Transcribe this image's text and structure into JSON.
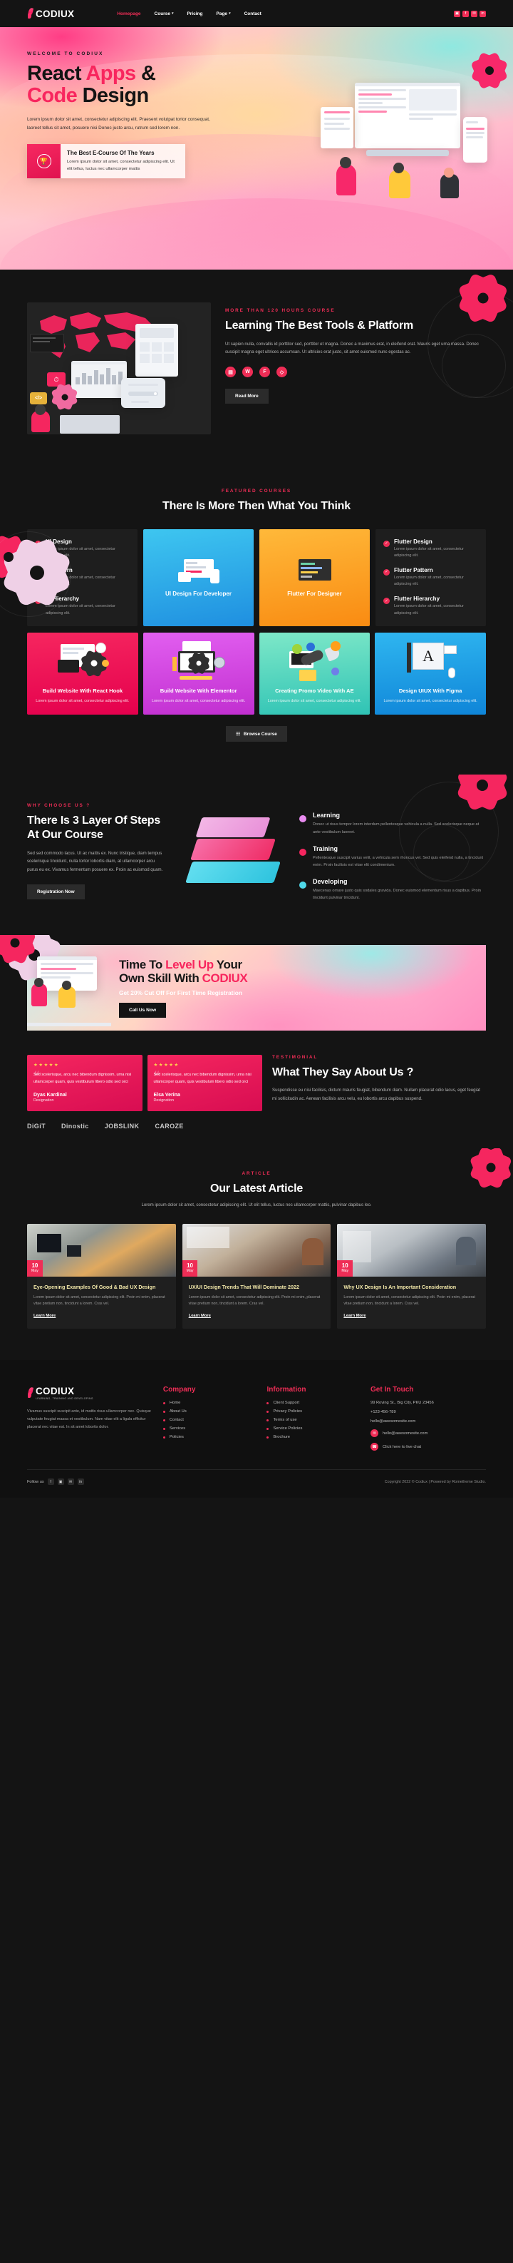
{
  "brand": {
    "name": "CODIUX",
    "tagline": "LEARNING, TRAINING AND DEVELOPING",
    "accent": "#ef2d56",
    "dark": "#141414"
  },
  "nav": {
    "items": [
      {
        "label": "Homepage",
        "active": true,
        "caret": ""
      },
      {
        "label": "Course",
        "active": false,
        "caret": "⌄"
      },
      {
        "label": "Pricing",
        "active": false,
        "caret": ""
      },
      {
        "label": "Page",
        "active": false,
        "caret": "⌄"
      },
      {
        "label": "Contact",
        "active": false,
        "caret": ""
      }
    ],
    "social": [
      {
        "name": "instagram-icon",
        "glyph": "▣"
      },
      {
        "name": "facebook-icon",
        "glyph": "f"
      },
      {
        "name": "twitter-icon",
        "glyph": "✉"
      },
      {
        "name": "linkedin-icon",
        "glyph": "in"
      }
    ]
  },
  "hero": {
    "eyebrow": "WELCOME TO CODIUX",
    "title_1a": "React ",
    "title_1b": "Apps",
    "title_1c": " &",
    "title_2a": "Code ",
    "title_2b": "Design",
    "paragraph": "Lorem ipsum dolor sit amet, consectetur adipiscing elit. Praesent volutpat tortor consequat, laoreet tellus sit amet, posuere nisi Donec justo arcu, rutrum sed lorem non.",
    "card": {
      "icon": "trophy-icon",
      "title": "The Best E-Course Of The Years",
      "text": "Lorem ipsum dolor sit amet, consectetur adipiscing elit. Ut elit tellus, luctus nec ullamcorper mattis"
    }
  },
  "learning": {
    "eyebrow": "MORE THAN 120 HOURS COURSE",
    "title": "Learning The Best Tools & Platform",
    "paragraph": "Ut sapien nulla, convallis id porttitor sed, porttitor et magna. Donec a maximus erat, in eleifend erat. Mauris eget urna massa. Donec suscipit magna eget ultrices accumsan. Ut ultricies erat justo, sit amet euismod nunc egestas ac.",
    "tools": [
      {
        "name": "elementor-icon",
        "glyph": "▤"
      },
      {
        "name": "wordpress-icon",
        "glyph": "W"
      },
      {
        "name": "figma-icon",
        "glyph": "F"
      },
      {
        "name": "sketch-icon",
        "glyph": "◇"
      }
    ],
    "button": "Read More"
  },
  "featured": {
    "eyebrow": "FEATURED COURSES",
    "title": "There Is More Then What You Think",
    "col1": [
      {
        "title": "UI Design",
        "text": "Lorem ipsum dolor sit amet, consectetur adipiscing elit."
      },
      {
        "title": "UI Pattern",
        "text": "Lorem ipsum dolor sit amet, consectetur adipiscing elit."
      },
      {
        "title": "UI Hierarchy",
        "text": "Lorem ipsum dolor sit amet, consectetur adipiscing elit."
      }
    ],
    "promo1": {
      "title": "UI Design For Developer"
    },
    "promo2": {
      "title": "Flutter For Designer"
    },
    "col4": [
      {
        "title": "Flutter Design",
        "text": "Lorem ipsum dolor sit amet, consectetur adipiscing elit."
      },
      {
        "title": "Flutter Pattern",
        "text": "Lorem ipsum dolor sit amet, consectetur adipiscing elit."
      },
      {
        "title": "Flutter Hierarchy",
        "text": "Lorem ipsum dolor sit amet, consectetur adipiscing elit."
      }
    ],
    "cards": [
      {
        "title": "Build Website With React Hook",
        "text": "Lorem ipsum dolor sit amet, consectetur adipiscing elit."
      },
      {
        "title": "Build Website With Elementor",
        "text": "Lorem ipsum dolor sit amet, consectetur adipiscing elit."
      },
      {
        "title": "Creating Promo Video With AE",
        "text": "Lorem ipsum dolor sit amet, consectetur adipiscing elit."
      },
      {
        "title": "Design UIUX With Figma",
        "text": "Lorem ipsum dolor sit amet, consectetur adipiscing elit."
      }
    ],
    "browse_button": "Browse Course"
  },
  "why": {
    "eyebrow": "WHY CHOOSE US ?",
    "title": "There Is 3 Layer Of Steps At Our Course",
    "paragraph": "Sed sed commodo lacus. Ut ac mattis ex. Nunc tristique, diam tempus scelerisque tincidunt, nulla tortor lobortis diam, at ullamcorper arcu purus eu ex. Vivamus fermentum posuere ex. Proin ac euismod quam.",
    "button": "Registration Now",
    "steps": [
      {
        "title": "Learning",
        "color": "#e98bf0",
        "text": "Donec ut risus tempor lorem interdum pellentesque vehicula a nulla. Sed scelerisque neque at ante vestibulum laoreet."
      },
      {
        "title": "Training",
        "color": "#f5265f",
        "text": "Pellentesque suscipit varius velit, a vehicula sem rhoncus vel. Sed quis eleifend nulla, a tincidunt enim. Proin facilisis est vitae elit condimentum."
      },
      {
        "title": "Developing",
        "color": "#4fd8e8",
        "text": "Maecenas ornare justo quis sodales gravida. Donec euismod elementum risus a dapibus. Proin tincidunt pulvinar tincidunt."
      }
    ]
  },
  "cta": {
    "line1a": "Time To ",
    "line1b": "Level Up",
    "line1c": " Your",
    "line2a": "Own Skill With ",
    "line2b": "CODIUX",
    "subtitle": "Get 20% Cut Off For First Time Registration",
    "button": "Call Us Now"
  },
  "testimonial": {
    "eyebrow": "TESTIMONIAL",
    "title": "What They Say About Us ?",
    "paragraph": "Suspendisse eu nisi facilisis, dictum mauris feugiat, bibendum diam. Nullam placerat odio lacus, eget feugiat mi sollicitudin ac. Aenean facilisis arcu velu, eu lobortis arcu dapibus suspend.",
    "cards": [
      {
        "stars": "★★★★★",
        "quote": "Sed scelerisque, arcu nec bibendum dignissim, urna nisi ullamcorper quam, quis vestibulum libero odio sed orci",
        "name": "Dyas Kardinal",
        "designation": "Designation"
      },
      {
        "stars": "★★★★★",
        "quote": "Sed scelerisque, arcu nec bibendum dignissim, urna nisi ullamcorper quam, quis vestibulum libero odio sed orci",
        "name": "Elsa Verina",
        "designation": "Designation"
      }
    ],
    "brands": [
      "DiGiT",
      "Dinostic",
      "JOBSLINK",
      "CAROZE"
    ]
  },
  "articles": {
    "eyebrow": "ARTICLE",
    "title": "Our Latest Article",
    "paragraph": "Lorem ipsum dolor sit amet, consectetur adipiscing elit. Ut elit tellus, luctus nec ullamcorper mattis, pulvinar dapibus leo.",
    "items": [
      {
        "day": "10",
        "month": "May",
        "title": "Eye-Opening Examples Of Good & Bad UX Design",
        "text": "Lorem ipsum dolor sit amet, consectetur adipiscing elit. Proin mi enim, placerat vitae pretium non, tincidunt a lorem. Cras vel.",
        "link": "Learn More"
      },
      {
        "day": "10",
        "month": "May",
        "title": "UX/UI Design Trends That Will Dominate 2022",
        "text": "Lorem ipsum dolor sit amet, consectetur adipiscing elit. Proin mi enim, placerat vitae pretium non, tincidunt a lorem. Cras vel.",
        "link": "Learn More"
      },
      {
        "day": "10",
        "month": "May",
        "title": "Why UX Design Is An Important Consideration",
        "text": "Lorem ipsum dolor sit amet, consectetur adipiscing elit. Proin mi enim, placerat vitae pretium non, tincidunt a lorem. Cras vel.",
        "link": "Learn More"
      }
    ]
  },
  "footer": {
    "about": "Vivamus suscipit suscipit ante, id mattis risus ullamcorper nec. Quisque vulputate feugiat massa et vestibulum. Nam vitae elit a ligula efficitur placerat nec vitae est. In sit amet lobortis dolor.",
    "company": {
      "heading": "Company",
      "items": [
        "Home",
        "About Us",
        "Contact",
        "Services",
        "Policies"
      ]
    },
    "information": {
      "heading": "Information",
      "items": [
        "Client Support",
        "Privacy Policies",
        "Terms of use",
        "Service Policies",
        "Brochure"
      ]
    },
    "contact": {
      "heading": "Get In Touch",
      "address": "99 Roving St., Big City, PKU 23456",
      "phone": "+123-456-789",
      "email": "hello@awesomesite.com",
      "email_link": "hello@awesomesite.com",
      "chat_link": "Click here to live chat"
    },
    "bottom": {
      "follow_label": "Follow us",
      "social": [
        {
          "name": "facebook-icon",
          "glyph": "f"
        },
        {
          "name": "instagram-icon",
          "glyph": "▣"
        },
        {
          "name": "twitter-icon",
          "glyph": "✉"
        },
        {
          "name": "linkedin-icon",
          "glyph": "in"
        }
      ],
      "copyright": "Copyright 2022 © Codiux | Powered by Rometheme Studio."
    }
  }
}
